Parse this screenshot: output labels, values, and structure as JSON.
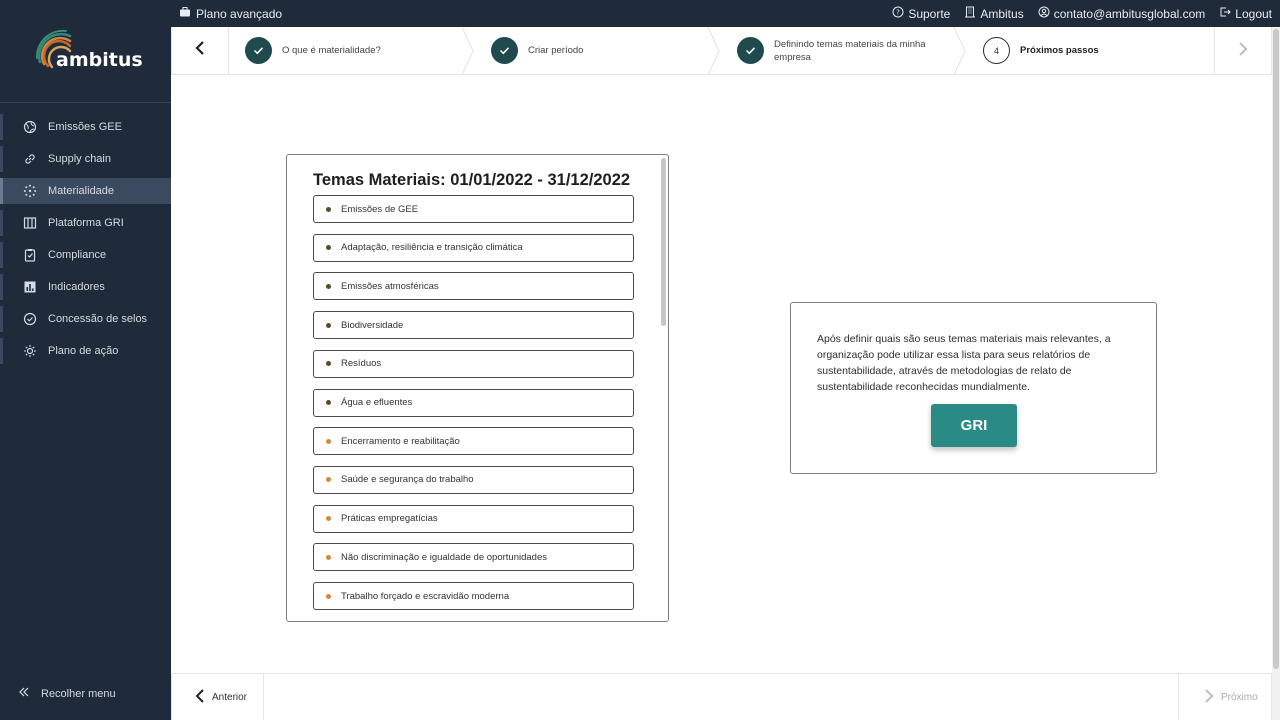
{
  "topbar": {
    "plan_label": "Plano avançado",
    "support_label": "Suporte",
    "company_label": "Ambitus",
    "email_label": "contato@ambitusglobal.com",
    "logout_label": "Logout"
  },
  "sidebar": {
    "logo_text": "ambitus",
    "items": [
      {
        "label": "Emissões GEE",
        "icon": "globe-icon"
      },
      {
        "label": "Supply chain",
        "icon": "link-icon"
      },
      {
        "label": "Materialidade",
        "icon": "dots-circle-icon",
        "active": true
      },
      {
        "label": "Plataforma GRI",
        "icon": "columns-icon"
      },
      {
        "label": "Compliance",
        "icon": "clipboard-check-icon"
      },
      {
        "label": "Indicadores",
        "icon": "bar-chart-icon"
      },
      {
        "label": "Concessão de selos",
        "icon": "badge-check-icon"
      },
      {
        "label": "Plano de ação",
        "icon": "sun-icon"
      }
    ],
    "collapse_label": "Recolher menu"
  },
  "stepper": {
    "steps": [
      {
        "label": "O que é materialidade?",
        "state": "done"
      },
      {
        "label": "Criar período",
        "state": "done"
      },
      {
        "label": "Definindo temas materiais da minha empresa",
        "state": "done"
      },
      {
        "number": "4",
        "label": "Próximos passos",
        "state": "current"
      }
    ]
  },
  "topics": {
    "title": "Temas Materiais: 01/01/2022 - 31/12/2022",
    "items": [
      {
        "label": "Emissões de GEE",
        "dot_color": "#5a4a2a"
      },
      {
        "label": "Adaptação, resiliência e transição climática",
        "dot_color": "#5a4a2a"
      },
      {
        "label": "Emissões atmosféricas",
        "dot_color": "#5a4a2a"
      },
      {
        "label": "Biodiversidade",
        "dot_color": "#5a4a2a"
      },
      {
        "label": "Resíduos",
        "dot_color": "#5a4a2a"
      },
      {
        "label": "Água e efluentes",
        "dot_color": "#5a4a2a"
      },
      {
        "label": "Encerramento e reabilitação",
        "dot_color": "#d08a3a"
      },
      {
        "label": "Saúde e segurança do trabalho",
        "dot_color": "#d08a3a"
      },
      {
        "label": "Práticas empregatícias",
        "dot_color": "#d08a3a"
      },
      {
        "label": "Não discriminação e igualdade de oportunidades",
        "dot_color": "#d08a3a"
      },
      {
        "label": "Trabalho forçado e escravidão moderna",
        "dot_color": "#d08a3a"
      }
    ]
  },
  "info": {
    "text": "Após definir quais são seus temas materiais mais relevantes, a organização pode utilizar essa lista para seus relatórios de sustentabilidade, através de metodologias de relato de sustentabilidade reconhecidas mundialmente.",
    "button_label": "GRI"
  },
  "footer": {
    "prev_label": "Anterior",
    "next_label": "Próximo"
  },
  "colors": {
    "sidebar_bg": "#1f2a3a",
    "step_done": "#1f4b4e",
    "accent": "#2a8a86"
  }
}
